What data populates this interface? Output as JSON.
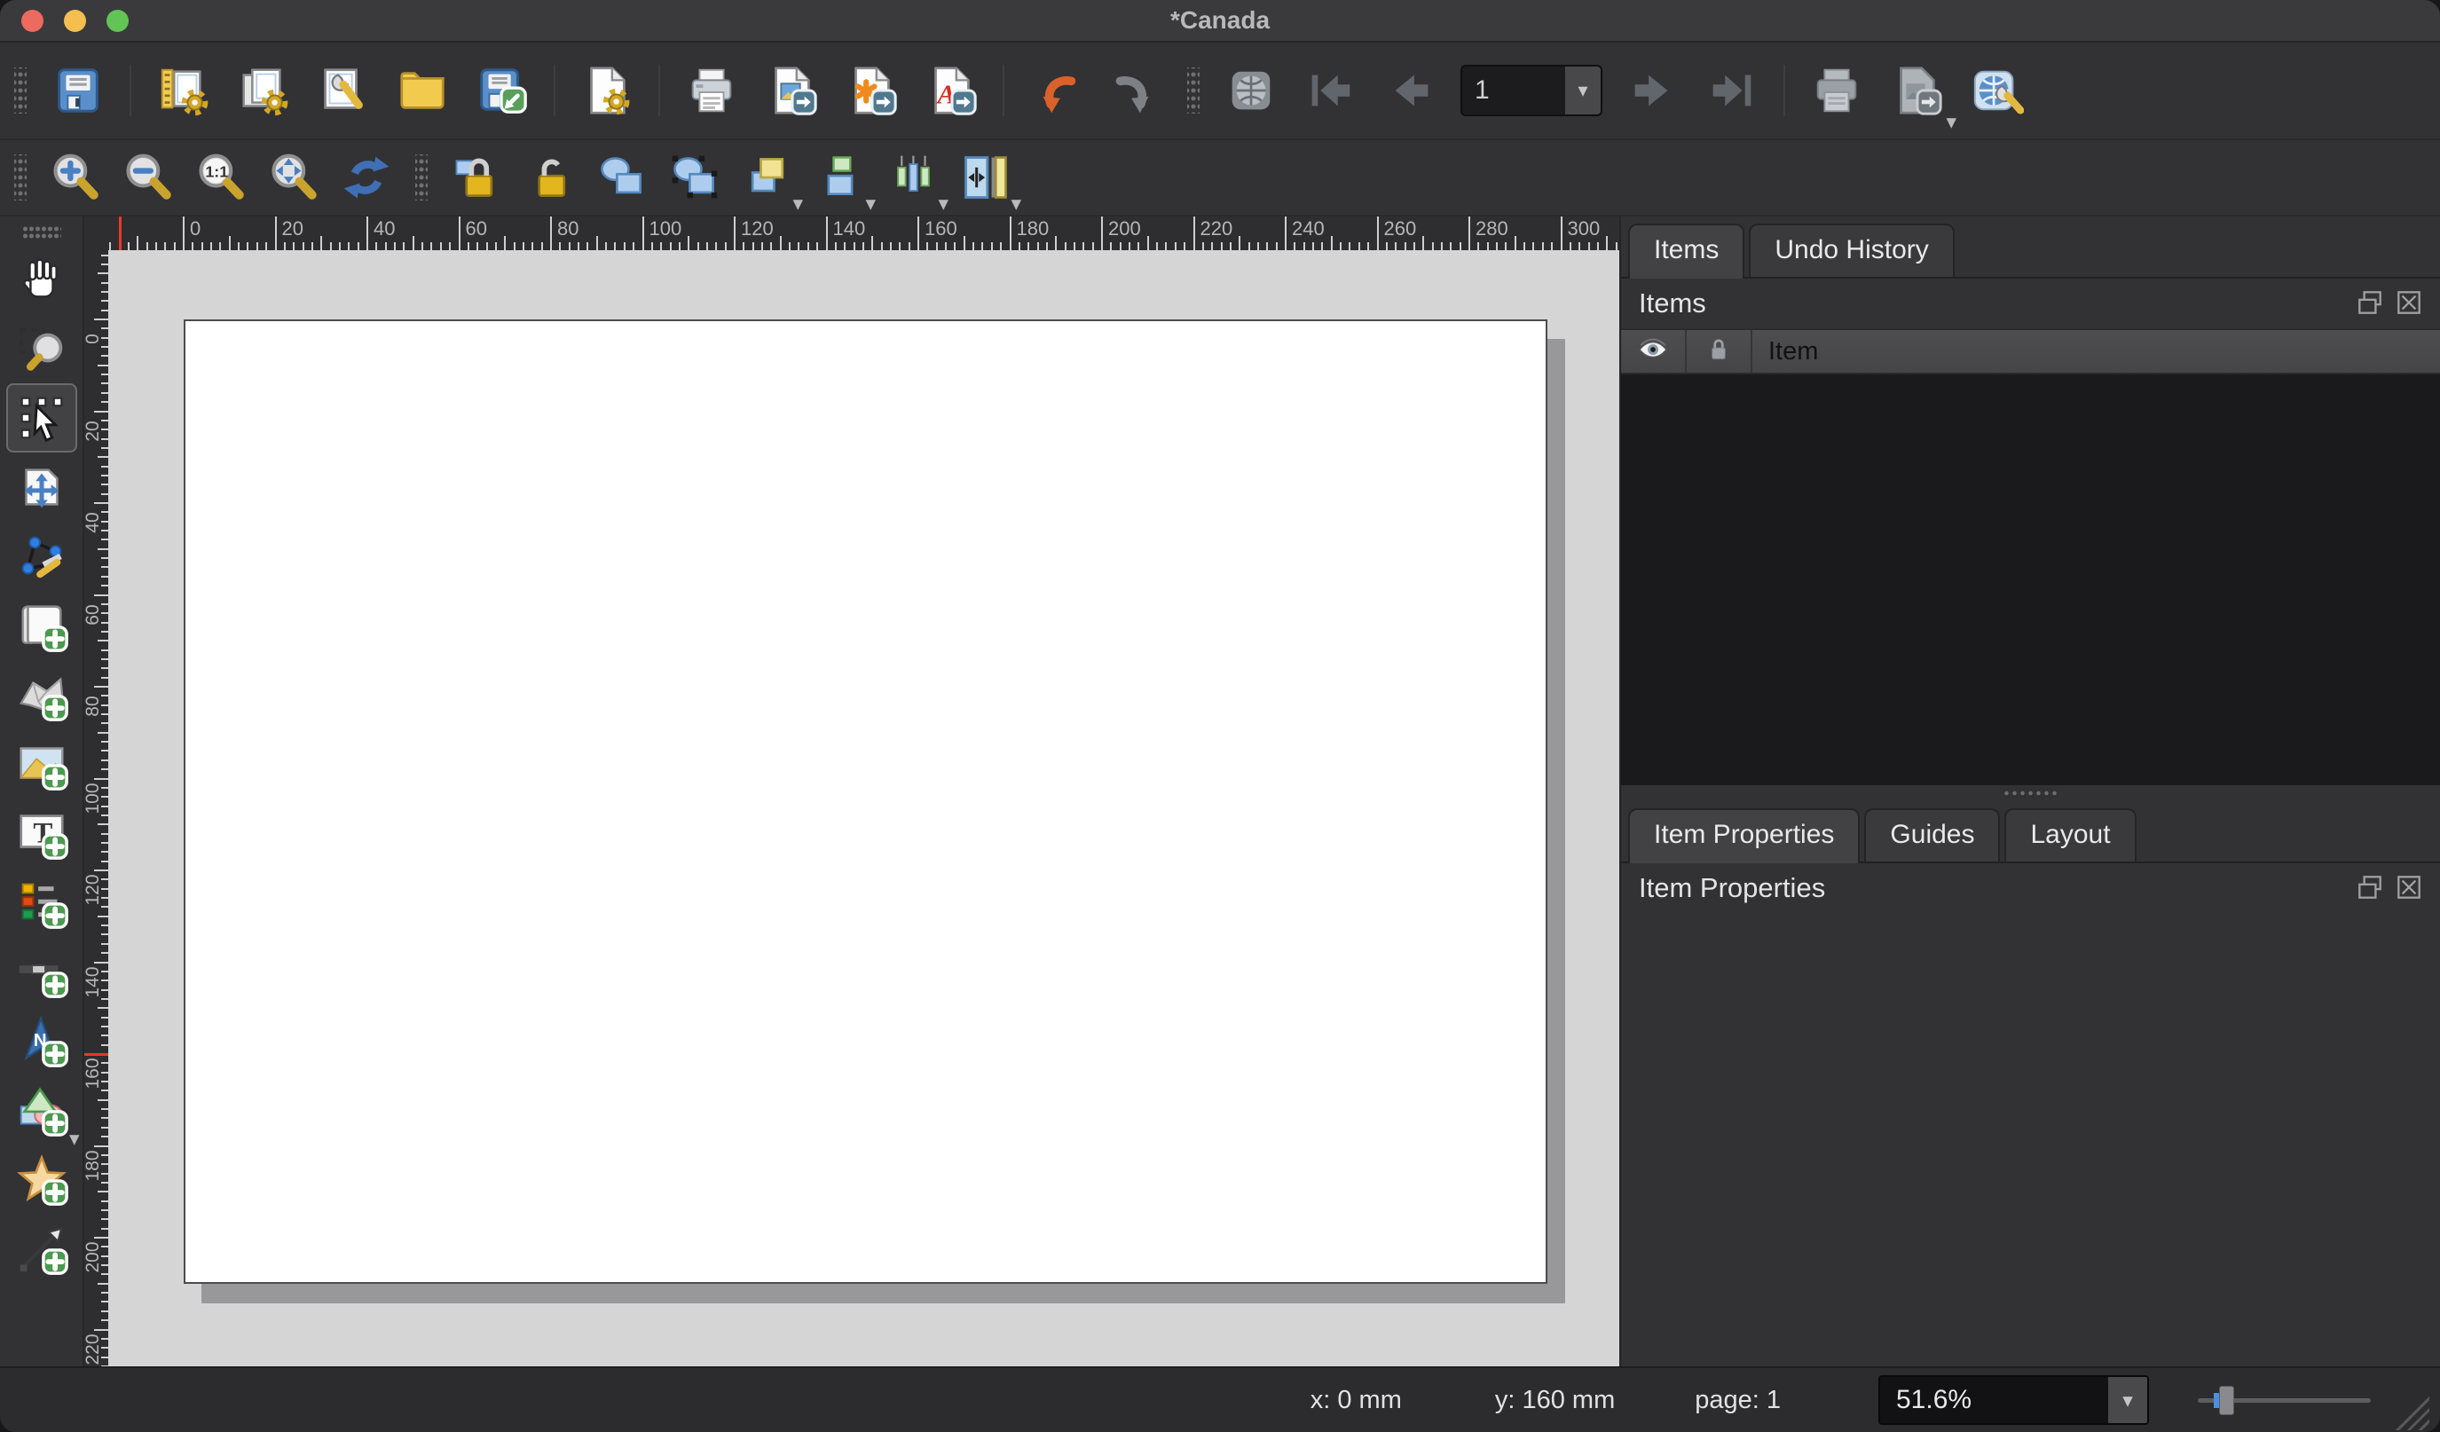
{
  "window": {
    "title": "*Canada"
  },
  "toolbars": {
    "layout": {
      "items": [
        {
          "type": "grip"
        },
        {
          "name": "save-project",
          "icon": "save"
        },
        {
          "type": "separator"
        },
        {
          "name": "new-layout",
          "icon": "new-layout"
        },
        {
          "name": "duplicate-layout",
          "icon": "duplicate-layout"
        },
        {
          "name": "layout-manager",
          "icon": "layout-manager"
        },
        {
          "name": "open-layout",
          "icon": "folder-open"
        },
        {
          "name": "save-as-template",
          "icon": "save-template"
        },
        {
          "type": "separator"
        },
        {
          "name": "add-pages",
          "icon": "add-pages"
        },
        {
          "type": "separator"
        },
        {
          "name": "print-layout",
          "icon": "printer"
        },
        {
          "name": "export-as-image",
          "icon": "export-image"
        },
        {
          "name": "export-as-svg",
          "icon": "export-svg"
        },
        {
          "name": "export-as-pdf",
          "icon": "export-pdf"
        },
        {
          "type": "separator"
        },
        {
          "name": "undo",
          "icon": "undo"
        },
        {
          "name": "redo",
          "icon": "redo",
          "disabled": true
        },
        {
          "type": "grip"
        },
        {
          "name": "preview-atlas",
          "icon": "atlas",
          "disabled": true
        },
        {
          "name": "first-feature",
          "icon": "nav-first",
          "disabled": true
        },
        {
          "name": "previous-feature",
          "icon": "nav-prev",
          "disabled": true
        },
        {
          "type": "spinbox",
          "name": "page-number",
          "value": "1"
        },
        {
          "name": "next-feature",
          "icon": "nav-next",
          "disabled": true
        },
        {
          "name": "last-feature",
          "icon": "nav-last",
          "disabled": true
        },
        {
          "type": "separator"
        },
        {
          "name": "print-atlas",
          "icon": "printer-disabled",
          "disabled": true
        },
        {
          "name": "export-atlas",
          "icon": "export-disabled",
          "disabled": true,
          "dropdown": true
        },
        {
          "name": "atlas-settings",
          "icon": "atlas-settings"
        }
      ]
    },
    "view": {
      "items": [
        {
          "type": "grip"
        },
        {
          "name": "zoom-in",
          "icon": "zoom-in"
        },
        {
          "name": "zoom-out",
          "icon": "zoom-out"
        },
        {
          "name": "zoom-actual-size",
          "icon": "zoom-actual"
        },
        {
          "name": "zoom-full",
          "icon": "zoom-full"
        },
        {
          "name": "refresh-view",
          "icon": "refresh"
        },
        {
          "type": "grip"
        },
        {
          "name": "lock-selected-items",
          "icon": "lock"
        },
        {
          "name": "unlock-all-items",
          "icon": "unlock"
        },
        {
          "name": "group-items",
          "icon": "group"
        },
        {
          "name": "ungroup-items",
          "icon": "ungroup"
        },
        {
          "name": "raise-selected-items",
          "icon": "raise",
          "dropdown": true
        },
        {
          "name": "align-selected-items",
          "icon": "align",
          "dropdown": true
        },
        {
          "name": "distribute-selected-items",
          "icon": "distribute",
          "dropdown": true
        },
        {
          "name": "resize-selected-items",
          "icon": "resize",
          "dropdown": true
        }
      ]
    },
    "toolbox": {
      "items": [
        {
          "type": "griph"
        },
        {
          "name": "pan-layout",
          "icon": "pan"
        },
        {
          "name": "zoom-tool",
          "icon": "zoom-region"
        },
        {
          "name": "select-move-item",
          "icon": "select-move",
          "active": true
        },
        {
          "name": "move-item-content",
          "icon": "move-content"
        },
        {
          "name": "edit-nodes-item",
          "icon": "edit-nodes"
        },
        {
          "name": "add-map",
          "icon": "add-map"
        },
        {
          "name": "add-3d-map",
          "icon": "add-3d-map"
        },
        {
          "name": "add-picture",
          "icon": "add-picture"
        },
        {
          "name": "add-label",
          "icon": "add-label"
        },
        {
          "name": "add-legend",
          "icon": "add-legend"
        },
        {
          "name": "add-scale-bar",
          "icon": "add-scale-bar"
        },
        {
          "name": "add-north-arrow",
          "icon": "add-north-arrow"
        },
        {
          "name": "add-shape",
          "icon": "add-shape",
          "dropdown": true
        },
        {
          "name": "add-marker",
          "icon": "add-marker"
        },
        {
          "name": "add-arrow",
          "icon": "add-arrow"
        }
      ]
    }
  },
  "rulers": {
    "unit": "mm",
    "horizontal": {
      "labels": [
        0,
        20,
        40,
        60,
        80,
        100,
        120,
        140,
        160,
        180,
        200,
        220,
        240,
        260,
        280,
        300
      ],
      "cursor_marker_mm": -14
    },
    "vertical": {
      "labels": [
        0,
        20,
        40,
        60,
        80,
        100,
        120,
        140,
        160,
        180,
        200,
        220
      ],
      "cursor_marker_mm": 160
    }
  },
  "panels": {
    "items": {
      "tabs": [
        {
          "label": "Items",
          "active": true
        },
        {
          "label": "Undo History",
          "active": false
        }
      ],
      "title": "Items",
      "header": {
        "columns": [
          "visibility",
          "lock",
          "item"
        ],
        "item_label": "Item"
      },
      "rows": []
    },
    "properties": {
      "tabs": [
        {
          "label": "Item Properties",
          "active": true
        },
        {
          "label": "Guides",
          "active": false
        },
        {
          "label": "Layout",
          "active": false
        }
      ],
      "title": "Item Properties"
    }
  },
  "status_bar": {
    "x_label": "x: 0 mm",
    "y_label": "y: 160 mm",
    "page_label": "page: 1",
    "zoom_value": "51.6%"
  },
  "colors": {
    "accent_blue": "#5b8fc9",
    "accent_yellow": "#e3b51f",
    "accent_green": "#4c9950",
    "undo_orange": "#d9622b",
    "cursor_red": "#e8392b",
    "canvas_gray": "#d5d5d6",
    "page_white": "#ffffff"
  }
}
